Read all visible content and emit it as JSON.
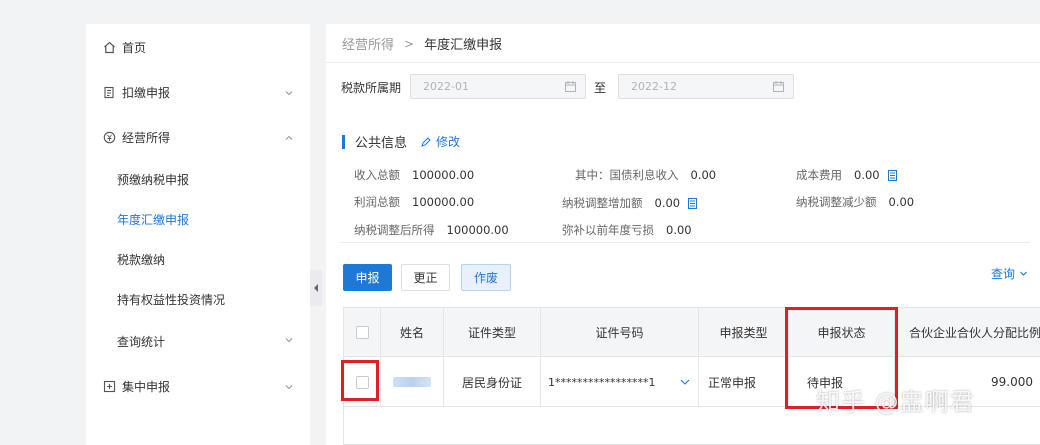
{
  "sidebar": {
    "items": [
      {
        "label": "首页",
        "icon": "home-icon"
      },
      {
        "label": "扣缴申报",
        "icon": "document-list-icon"
      },
      {
        "label": "经营所得",
        "icon": "money-circle-icon"
      },
      {
        "label": "集中申报",
        "icon": "plus-box-icon"
      }
    ],
    "sub_items": [
      {
        "label": "预缴纳税申报"
      },
      {
        "label": "年度汇缴申报"
      },
      {
        "label": "税款缴纳"
      },
      {
        "label": "持有权益性投资情况"
      },
      {
        "label": "查询统计"
      }
    ]
  },
  "breadcrumb": {
    "parent": "经营所得",
    "separator": ">",
    "current": "年度汇缴申报"
  },
  "period": {
    "label": "税款所属期",
    "start": "2022-01",
    "to_label": "至",
    "end": "2022-12"
  },
  "section": {
    "title": "公共信息",
    "edit_label": "修改"
  },
  "info": [
    {
      "label": "收入总额",
      "value": "100000.00"
    },
    {
      "label": "其中：国债利息收入",
      "value": "0.00"
    },
    {
      "label": "成本费用",
      "value": "0.00"
    },
    {
      "label": "利润总额",
      "value": "100000.00"
    },
    {
      "label": "纳税调整增加额",
      "value": "0.00"
    },
    {
      "label": "纳税调整减少额",
      "value": "0.00"
    },
    {
      "label": "纳税调整后所得",
      "value": "100000.00"
    },
    {
      "label": "弥补以前年度亏损",
      "value": "0.00"
    }
  ],
  "toolbar": {
    "declare": "申报",
    "correct": "更正",
    "void": "作废",
    "query": "查询"
  },
  "table": {
    "headers": [
      "姓名",
      "证件类型",
      "证件号码",
      "申报类型",
      "申报状态",
      "合伙企业合伙人分配比例"
    ],
    "row": {
      "id_type": "居民身份证",
      "id_number": "1*****************1",
      "declare_type": "正常申报",
      "status": "待申报",
      "ratio": "99.000"
    }
  },
  "watermark": "知乎 @盅啊君",
  "colors": {
    "accent": "#1e78d8",
    "highlight": "#e02020"
  }
}
